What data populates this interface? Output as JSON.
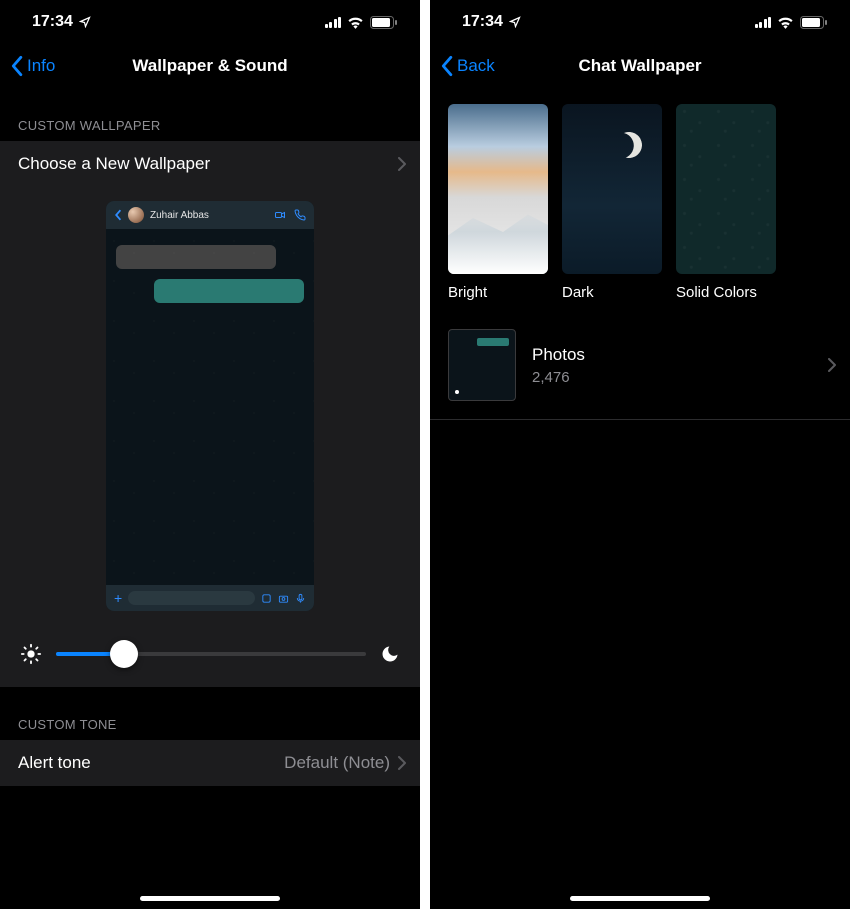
{
  "status": {
    "time": "17:34"
  },
  "left": {
    "nav": {
      "back": "Info",
      "title": "Wallpaper & Sound"
    },
    "sections": {
      "customWallpaperHeader": "Custom Wallpaper",
      "chooseNew": "Choose a New Wallpaper",
      "customToneHeader": "Custom Tone",
      "alertTone": {
        "label": "Alert tone",
        "value": "Default (Note)"
      }
    },
    "preview": {
      "contactName": "Zuhair Abbas"
    },
    "brightness": {
      "percent": 22
    }
  },
  "right": {
    "nav": {
      "back": "Back",
      "title": "Chat Wallpaper"
    },
    "options": {
      "bright": "Bright",
      "dark": "Dark",
      "solid": "Solid Colors"
    },
    "photos": {
      "label": "Photos",
      "count": "2,476"
    }
  }
}
